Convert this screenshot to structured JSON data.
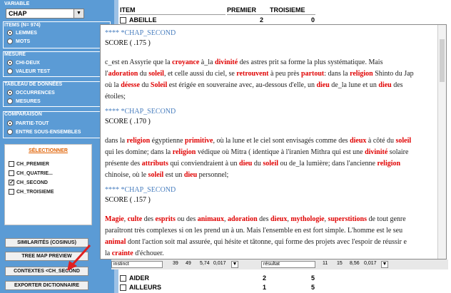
{
  "left": {
    "variable_label": "VARIABLE",
    "variable_value": "CHAP",
    "items_label": "ITEMS (N= 974)",
    "items_options": [
      "LEMMES",
      "MOTS"
    ],
    "mesure_label": "MESURE",
    "mesure_options": [
      "CHI-DEUX",
      "VALEUR TEST"
    ],
    "tableau_label": "TABLEAU DE DONNÉES",
    "tableau_options": [
      "OCCURRENCES",
      "MESURES"
    ],
    "comparaison_label": "COMPARAISON",
    "comparaison_options": [
      "PARTIE-TOUT",
      "ENTRE SOUS-ENSEMBLES"
    ],
    "select_title": "SÉLECTIONNER",
    "select_items": [
      "CH_PREMIER",
      "CH_QUATRIE...",
      "CH_SECOND",
      "CH_TROISIEME"
    ],
    "buttons": {
      "similarites": "SIMILARITÉS (COSINUS)",
      "treemap": "TREE MAP PREVIEW",
      "contextes": "CONTEXTES  <CH_SECOND",
      "exporter": "EXPORTER DICTIONNAIRE"
    }
  },
  "table": {
    "headers": [
      "ITEM",
      "PREMIER",
      "TROISIEME"
    ],
    "rows": [
      {
        "item": "ABEILLE",
        "premier": "2",
        "troisieme": "0"
      },
      {
        "item": "AIDER",
        "premier": "2",
        "troisieme": "5"
      },
      {
        "item": "AILLEURS",
        "premier": "1",
        "troisieme": "5"
      }
    ]
  },
  "stats": {
    "left_word": "instinct",
    "left_a": "39",
    "left_b": "49",
    "left_c": "5,74",
    "left_d": "0,017",
    "right_word": "résultat",
    "right_a": "11",
    "right_b": "15",
    "right_c": "8,56",
    "right_d": "0,017"
  },
  "popup": {
    "blocks": [
      {
        "header": "**** *CHAP_SECOND",
        "score": "SCORE ( .175 )",
        "lines": [
          [
            [
              "c_est en Assyrie que la ",
              0
            ],
            [
              "croyance",
              1
            ],
            [
              " à_la ",
              0
            ],
            [
              "divinité",
              1
            ],
            [
              " des astres prit sa forme la plus systématique. Mais",
              0
            ]
          ],
          [
            [
              "l'",
              0
            ],
            [
              "adoration",
              1
            ],
            [
              " du ",
              0
            ],
            [
              "soleil",
              1
            ],
            [
              ", et celle aussi du ciel, se ",
              0
            ],
            [
              "retrouvent",
              1
            ],
            [
              " à peu près ",
              0
            ],
            [
              "partout",
              1
            ],
            [
              ": dans la ",
              0
            ],
            [
              "religion",
              1
            ],
            [
              " Shinto du Jap",
              0
            ]
          ],
          [
            [
              "où la ",
              0
            ],
            [
              "déesse",
              1
            ],
            [
              " du ",
              0
            ],
            [
              "Soleil",
              1
            ],
            [
              " est érigée en souveraine avec, au-dessous d'elle, un ",
              0
            ],
            [
              "dieu",
              1
            ],
            [
              " de_la lune et un ",
              0
            ],
            [
              "dieu",
              1
            ],
            [
              " des",
              0
            ]
          ],
          [
            [
              "étoiles;",
              0
            ]
          ]
        ]
      },
      {
        "header": "**** *CHAP_SECOND",
        "score": "SCORE ( .170 )",
        "lines": [
          [
            [
              "dans la ",
              0
            ],
            [
              "religion",
              1
            ],
            [
              " égyptienne ",
              0
            ],
            [
              "primitive",
              1
            ],
            [
              ", où la lune et le ciel sont envisagés comme des ",
              0
            ],
            [
              "dieux",
              1
            ],
            [
              " à côté du ",
              0
            ],
            [
              "soleil",
              1
            ]
          ],
          [
            [
              "qui les domine; dans la ",
              0
            ],
            [
              "religion",
              1
            ],
            [
              " védique où Mitra ( identique à l'iranien Mithra qui est une ",
              0
            ],
            [
              "divinité",
              1
            ],
            [
              " solaire",
              0
            ]
          ],
          [
            [
              "présente des ",
              0
            ],
            [
              "attributs",
              1
            ],
            [
              " qui conviendraient à un ",
              0
            ],
            [
              "dieu",
              1
            ],
            [
              " du ",
              0
            ],
            [
              "soleil",
              1
            ],
            [
              " ou de_la lumière; dans l'ancienne ",
              0
            ],
            [
              "religion",
              1
            ]
          ],
          [
            [
              "chinoise, où le ",
              0
            ],
            [
              "soleil",
              1
            ],
            [
              " est un ",
              0
            ],
            [
              "dieu",
              1
            ],
            [
              " personnel;",
              0
            ]
          ]
        ]
      },
      {
        "header": "**** *CHAP_SECOND",
        "score": "SCORE ( .157 )",
        "lines": [
          [
            [
              "Magie",
              1
            ],
            [
              ", ",
              0
            ],
            [
              "culte",
              1
            ],
            [
              " des ",
              0
            ],
            [
              "esprits",
              1
            ],
            [
              " ou des ",
              0
            ],
            [
              "animaux",
              1
            ],
            [
              ", ",
              0
            ],
            [
              "adoration",
              1
            ],
            [
              " des ",
              0
            ],
            [
              "dieux",
              1
            ],
            [
              ", ",
              0
            ],
            [
              "mythologie",
              1
            ],
            [
              ", ",
              0
            ],
            [
              "superstitions",
              1
            ],
            [
              " de tout genre",
              0
            ]
          ],
          [
            [
              "paraîtront très complexes si on les prend un à un. Mais l'ensemble en est fort simple. L'homme est le seu",
              0
            ]
          ],
          [
            [
              "animal",
              1
            ],
            [
              " dont l'action soit mal assurée, qui hésite et tâtonne, qui forme des projets avec l'espoir de réussir e",
              0
            ]
          ],
          [
            [
              "la ",
              0
            ],
            [
              "crainte",
              1
            ],
            [
              " d'échouer.",
              0
            ]
          ]
        ]
      }
    ]
  }
}
